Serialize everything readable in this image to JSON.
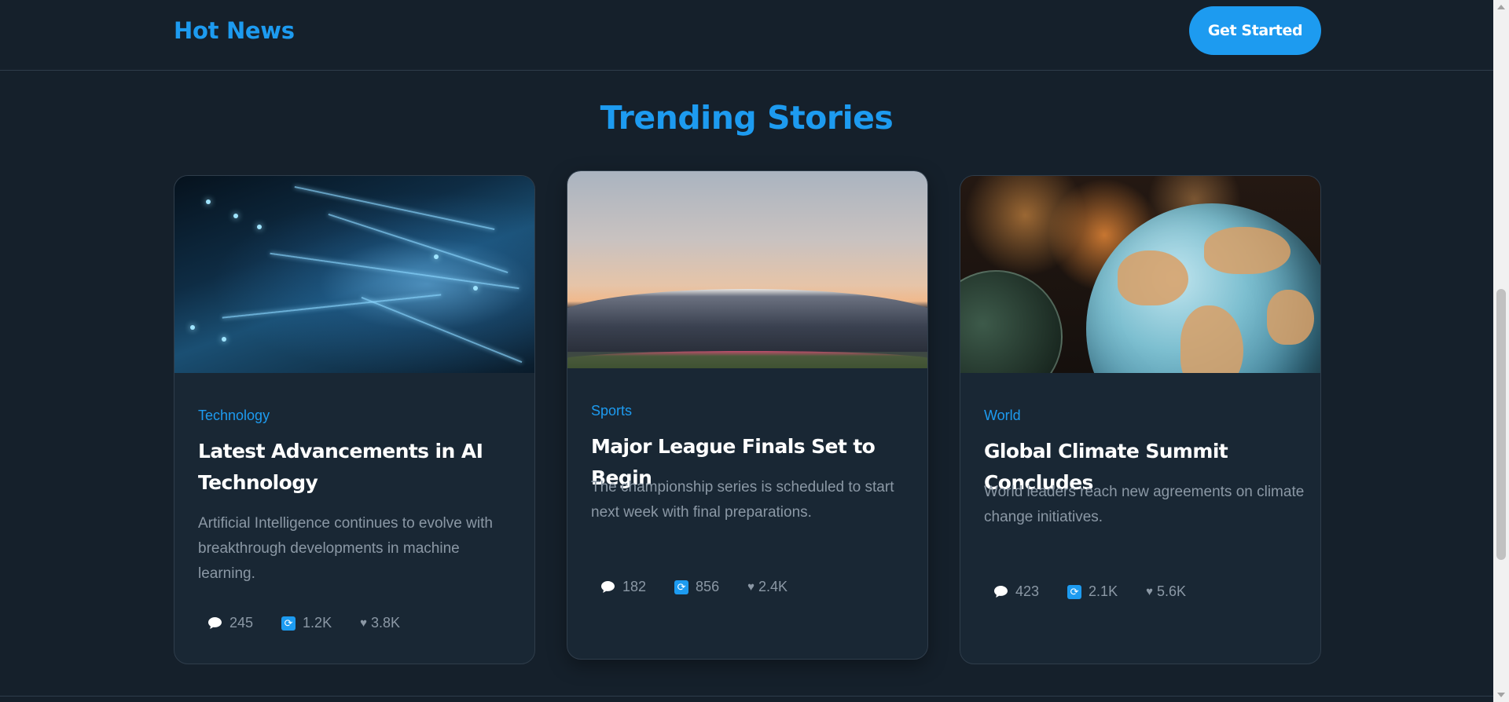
{
  "header": {
    "brand": "Hot News",
    "cta_label": "Get Started"
  },
  "section": {
    "title": "Trending Stories"
  },
  "cards": [
    {
      "category": "Technology",
      "title": "Latest Advancements in AI Technology",
      "description": "Artificial Intelligence continues to evolve with breakthrough developments in machine learning.",
      "image": "circuit-board-image",
      "stats": {
        "comments": "245",
        "shares": "1.2K",
        "likes": "3.8K"
      }
    },
    {
      "category": "Sports",
      "title": "Major League Finals Set to Begin",
      "description": "The championship series is scheduled to start next week with final preparations.",
      "image": "stadium-image",
      "stats": {
        "comments": "182",
        "shares": "856",
        "likes": "2.4K"
      }
    },
    {
      "category": "World",
      "title": "Global Climate Summit Concludes",
      "description": "World leaders reach new agreements on climate change initiatives.",
      "image": "globe-image",
      "stats": {
        "comments": "423",
        "shares": "2.1K",
        "likes": "5.6K"
      }
    }
  ],
  "icons": {
    "comment": "comment-icon",
    "share": "retweet-icon",
    "like": "heart-icon"
  },
  "colors": {
    "background": "#15202b",
    "card": "#192734",
    "accent": "#1d9bf0",
    "muted_text": "#8b98a5",
    "border": "#2f3d4b"
  }
}
